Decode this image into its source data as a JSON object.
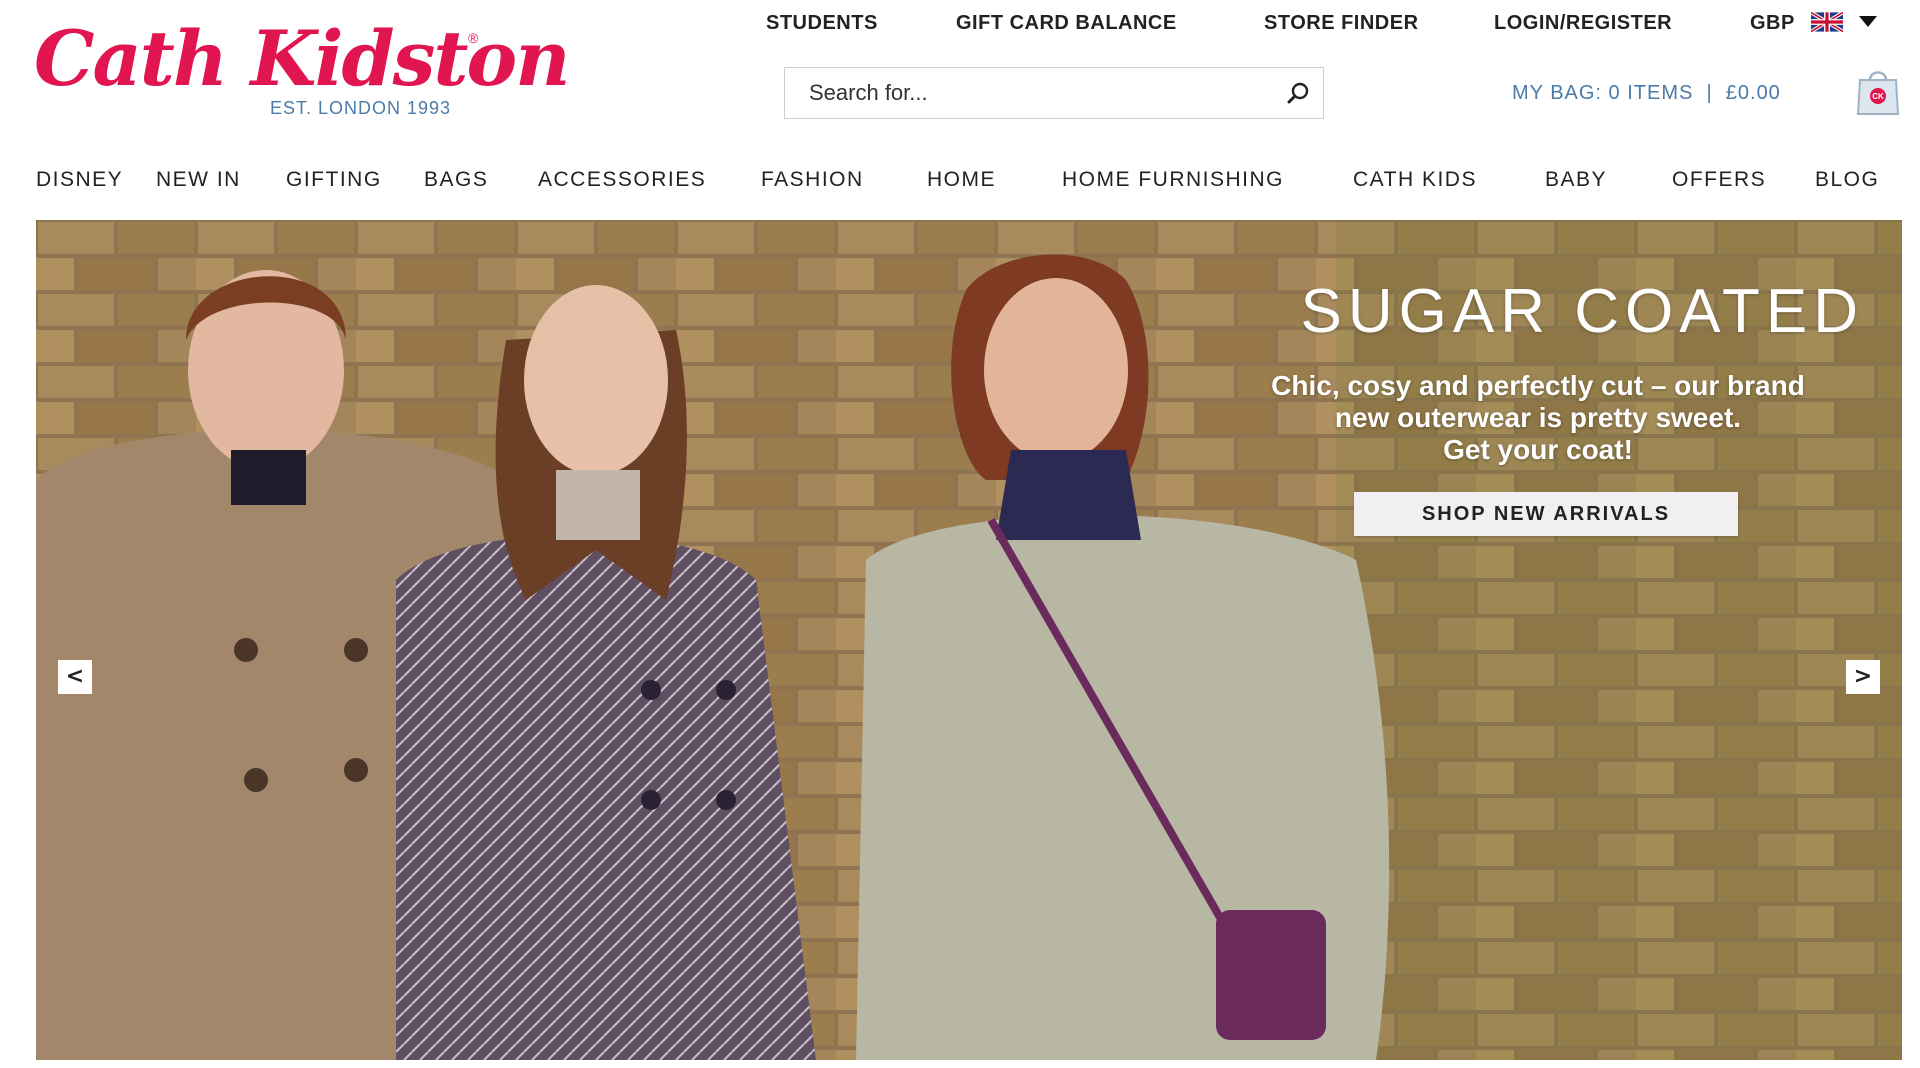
{
  "brand": {
    "name": "Cath Kidston",
    "registered": "®",
    "tagline": "EST. LONDON 1993",
    "color": "#e1154f",
    "secondary_color": "#4c7ba8"
  },
  "utility_nav": {
    "students": "STUDENTS",
    "gift_card_balance": "GIFT CARD BALANCE",
    "store_finder": "STORE FINDER",
    "login_register": "LOGIN/REGISTER",
    "currency": "GBP",
    "currency_flag_icon": "uk-flag-icon",
    "currency_dropdown_icon": "caret-down-icon"
  },
  "search": {
    "placeholder": "Search for...",
    "value": "",
    "icon": "search-icon"
  },
  "bag": {
    "label": "MY BAG: 0 ITEMS  |  £0.00",
    "icon": "shopping-bag-icon",
    "icon_text": "CK"
  },
  "main_nav": {
    "items": [
      "DISNEY",
      "NEW IN",
      "GIFTING",
      "BAGS",
      "ACCESSORIES",
      "FASHION",
      "HOME",
      "HOME FURNISHING",
      "CATH KIDS",
      "BABY",
      "OFFERS",
      "BLOG"
    ]
  },
  "hero": {
    "title": "SUGAR COATED",
    "copy_lines": [
      "Chic, cosy and perfectly cut – our brand",
      "new outerwear is pretty sweet.",
      "Get your coat!"
    ],
    "cta": "SHOP NEW ARRIVALS",
    "prev_label": "<",
    "next_label": ">",
    "image": "three-women-in-coats-against-brick-wall"
  }
}
